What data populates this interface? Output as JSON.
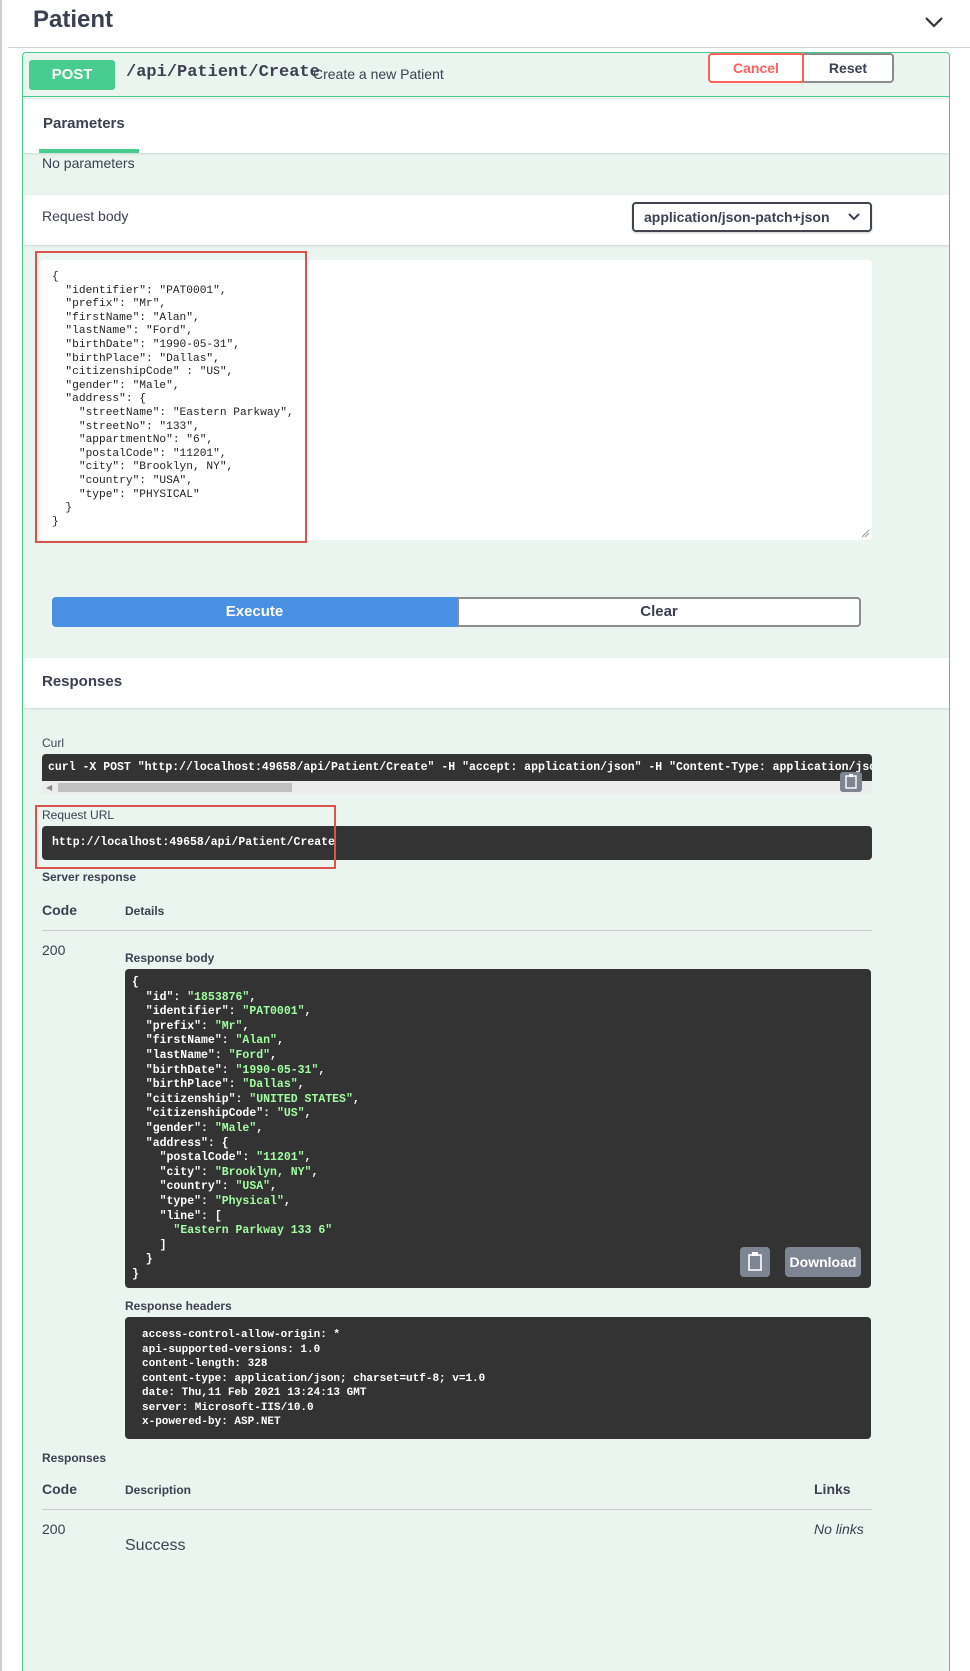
{
  "tag": {
    "title": "Patient"
  },
  "operation": {
    "method": "POST",
    "path": "/api/Patient/Create",
    "summary": "Create a new Patient"
  },
  "parameters": {
    "tab_label": "Parameters",
    "cancel_label": "Cancel",
    "reset_label": "Reset",
    "no_params_text": "No parameters"
  },
  "request_body": {
    "label": "Request body",
    "content_type": "application/json-patch+json",
    "editor_text": "{\n  \"identifier\": \"PAT0001\",\n  \"prefix\": \"Mr\",\n  \"firstName\": \"Alan\",\n  \"lastName\": \"Ford\",\n  \"birthDate\": \"1990-05-31\",\n  \"birthPlace\": \"Dallas\",\n  \"citizenshipCode\" : \"US\",\n  \"gender\": \"Male\",\n  \"address\": {\n    \"streetName\": \"Eastern Parkway\",\n    \"streetNo\": \"133\",\n    \"appartmentNo\": \"6\",\n    \"postalCode\": \"11201\",\n    \"city\": \"Brooklyn, NY\",\n    \"country\": \"USA\",\n    \"type\": \"PHYSICAL\"\n  }\n}"
  },
  "actions": {
    "execute_label": "Execute",
    "clear_label": "Clear"
  },
  "responses_title": "Responses",
  "curl": {
    "label": "Curl",
    "command": "curl -X POST \"http://localhost:49658/api/Patient/Create\" -H  \"accept: application/json\" -H  \"Content-Type: application/json-patch+json\""
  },
  "request_url": {
    "label": "Request URL",
    "value": "http://localhost:49658/api/Patient/Create"
  },
  "server_response": {
    "label": "Server response",
    "col_code": "Code",
    "col_details": "Details",
    "code": "200",
    "response_body_label": "Response body",
    "response_body": [
      {
        "t": "{",
        "s": ""
      },
      {
        "t": "  \"id\": ",
        "s": "\"1853876\"",
        "e": ","
      },
      {
        "t": "  \"identifier\": ",
        "s": "\"PAT0001\"",
        "e": ","
      },
      {
        "t": "  \"prefix\": ",
        "s": "\"Mr\"",
        "e": ","
      },
      {
        "t": "  \"firstName\": ",
        "s": "\"Alan\"",
        "e": ","
      },
      {
        "t": "  \"lastName\": ",
        "s": "\"Ford\"",
        "e": ","
      },
      {
        "t": "  \"birthDate\": ",
        "s": "\"1990-05-31\"",
        "e": ","
      },
      {
        "t": "  \"birthPlace\": ",
        "s": "\"Dallas\"",
        "e": ","
      },
      {
        "t": "  \"citizenship\": ",
        "s": "\"UNITED STATES\"",
        "e": ","
      },
      {
        "t": "  \"citizenshipCode\": ",
        "s": "\"US\"",
        "e": ","
      },
      {
        "t": "  \"gender\": ",
        "s": "\"Male\"",
        "e": ","
      },
      {
        "t": "  \"address\": {",
        "s": ""
      },
      {
        "t": "    \"postalCode\": ",
        "s": "\"11201\"",
        "e": ","
      },
      {
        "t": "    \"city\": ",
        "s": "\"Brooklyn, NY\"",
        "e": ","
      },
      {
        "t": "    \"country\": ",
        "s": "\"USA\"",
        "e": ","
      },
      {
        "t": "    \"type\": ",
        "s": "\"Physical\"",
        "e": ","
      },
      {
        "t": "    \"line\": [",
        "s": ""
      },
      {
        "t": "      ",
        "s": "\"Eastern Parkway 133 6\""
      },
      {
        "t": "    ]",
        "s": ""
      },
      {
        "t": "  }",
        "s": ""
      },
      {
        "t": "}",
        "s": ""
      }
    ],
    "download_label": "Download",
    "response_headers_label": "Response headers",
    "response_headers": "access-control-allow-origin: *\napi-supported-versions: 1.0\ncontent-length: 328\ncontent-type: application/json; charset=utf-8; v=1.0\ndate: Thu,11 Feb 2021 13:24:13 GMT\nserver: Microsoft-IIS/10.0\nx-powered-by: ASP.NET"
  },
  "responses_table": {
    "label": "Responses",
    "col_code": "Code",
    "col_description": "Description",
    "col_links": "Links",
    "code": "200",
    "description": "Success",
    "links": "No links"
  },
  "colors": {
    "post_green": "#49cc90",
    "block_bg": "#eaf5ef",
    "execute_blue": "#4990e2",
    "cancel_red": "#ff6060",
    "highlight_red": "#d9534f",
    "code_bg": "#333333",
    "code_string": "#a2fca2"
  }
}
